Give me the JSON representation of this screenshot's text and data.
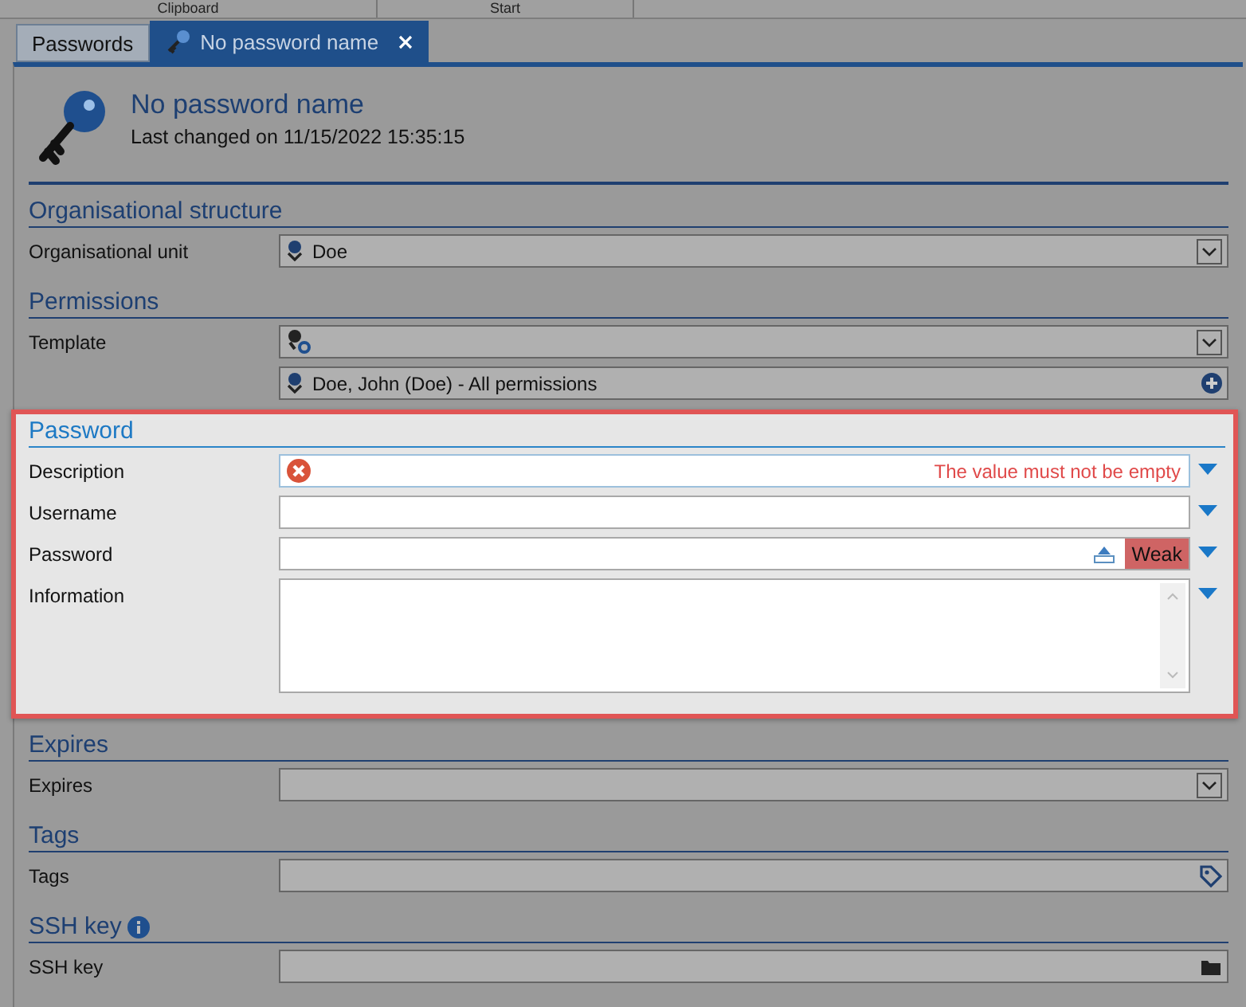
{
  "ribbon_groups": [
    "Clipboard",
    "Start"
  ],
  "tabs": [
    {
      "label": "Passwords",
      "selected": false,
      "closable": false
    },
    {
      "label": "No password name",
      "selected": true,
      "closable": true
    }
  ],
  "header": {
    "title": "No password name",
    "subtitle": "Last changed on 11/15/2022 15:35:15"
  },
  "sections": [
    {
      "heading": "Organisational structure",
      "highlighted": false,
      "info": false,
      "fields": [
        {
          "kind": "user-select",
          "label": "Organisational unit",
          "value": "Doe",
          "options_menu": false
        }
      ]
    },
    {
      "heading": "Permissions",
      "highlighted": false,
      "info": false,
      "fields": [
        {
          "kind": "template-select",
          "label": "Template",
          "options_menu": false
        },
        {
          "kind": "permission-entry",
          "value": "Doe, John (Doe) - All permissions",
          "options_menu": false
        }
      ]
    },
    {
      "heading": "Password",
      "highlighted": true,
      "info": false,
      "fields": [
        {
          "kind": "text",
          "label": "Description",
          "error": "The value must not be empty",
          "options_menu": true
        },
        {
          "kind": "text",
          "label": "Username",
          "options_menu": true
        },
        {
          "kind": "password",
          "label": "Password",
          "strength": "Weak",
          "options_menu": true
        },
        {
          "kind": "multiline",
          "label": "Information",
          "options_menu": true
        }
      ]
    },
    {
      "heading": "Expires",
      "highlighted": false,
      "info": false,
      "fields": [
        {
          "kind": "dropdown",
          "label": "Expires",
          "options_menu": false
        }
      ]
    },
    {
      "heading": "Tags",
      "highlighted": false,
      "info": false,
      "fields": [
        {
          "kind": "tags",
          "label": "Tags",
          "options_menu": false
        }
      ]
    },
    {
      "heading": "SSH key",
      "highlighted": false,
      "info": true,
      "fields": [
        {
          "kind": "file",
          "label": "SSH key",
          "options_menu": false
        }
      ]
    }
  ]
}
